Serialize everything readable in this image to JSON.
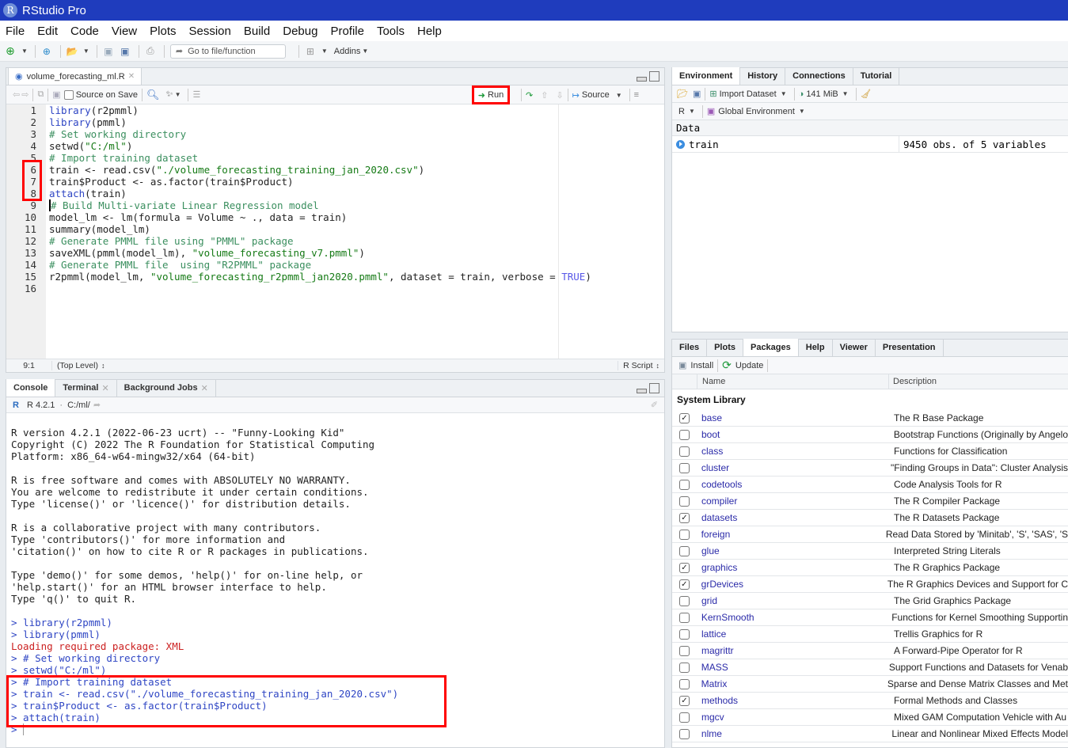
{
  "app": {
    "title": "RStudio Pro",
    "logo_letter": "R"
  },
  "menu": [
    "File",
    "Edit",
    "Code",
    "View",
    "Plots",
    "Session",
    "Build",
    "Debug",
    "Profile",
    "Tools",
    "Help"
  ],
  "toolbar": {
    "goto_placeholder": "Go to file/function",
    "addins_label": "Addins"
  },
  "source": {
    "tab_label": "volume_forecasting_ml.R",
    "source_on_save_label": "Source on Save",
    "run_label": "Run",
    "source_label": "Source",
    "line_numbers": [
      "1",
      "2",
      "3",
      "4",
      "5",
      "6",
      "7",
      "8",
      "9",
      "10",
      "11",
      "12",
      "13",
      "14",
      "15",
      "16"
    ],
    "status_position": "9:1",
    "status_scope": "(Top Level)",
    "status_type": "R Script"
  },
  "code": {
    "l1_fn": "library",
    "l1_rest": "(r2pmml)",
    "l2_fn": "library",
    "l2_rest": "(pmml)",
    "l3": "# Set working directory",
    "l4_a": "setwd(",
    "l4_s": "\"C:/ml\"",
    "l4_b": ")",
    "l5": "# Import training dataset",
    "l6_a": "train <- read.csv(",
    "l6_s": "\"./volume_forecasting_training_jan_2020.csv\"",
    "l6_b": ")",
    "l7": "train$Product <- as.factor(train$Product)",
    "l8_fn": "attach",
    "l8_rest": "(train)",
    "l9": "# Build Multi-variate Linear Regression model",
    "l10": "model_lm <- lm(formula = Volume ~ ., data = train)",
    "l11": "summary(model_lm)",
    "l12": "# Generate PMML file using \"PMML\" package",
    "l13_a": "saveXML(pmml(model_lm), ",
    "l13_s": "\"volume_forecasting_v7.pmml\"",
    "l13_b": ")",
    "l14": "# Generate PMML file  using \"R2PMML\" package",
    "l15_a": "r2pmml(model_lm, ",
    "l15_s": "\"volume_forecasting_r2pmml_jan2020.pmml\"",
    "l15_b": ", dataset = train, verbose = ",
    "l15_t": "TRUE",
    "l15_c": ")"
  },
  "console": {
    "tabs": [
      "Console",
      "Terminal",
      "Background Jobs"
    ],
    "r_version": "R 4.2.1",
    "path": "C:/ml/",
    "startup": [
      "R version 4.2.1 (2022-06-23 ucrt) -- \"Funny-Looking Kid\"",
      "Copyright (C) 2022 The R Foundation for Statistical Computing",
      "Platform: x86_64-w64-mingw32/x64 (64-bit)",
      "",
      "R is free software and comes with ABSOLUTELY NO WARRANTY.",
      "You are welcome to redistribute it under certain conditions.",
      "Type 'license()' or 'licence()' for distribution details.",
      "",
      "R is a collaborative project with many contributors.",
      "Type 'contributors()' for more information and",
      "'citation()' on how to cite R or R packages in publications.",
      "",
      "Type 'demo()' for some demos, 'help()' for on-line help, or",
      "'help.start()' for an HTML browser interface to help.",
      "Type 'q()' to quit R.",
      ""
    ],
    "cmd1": "> library(r2pmml)",
    "cmd2": "> library(pmml)",
    "msg": "Loading required package: XML",
    "cmd3": "> # Set working directory",
    "cmd4": "> setwd(\"C:/ml\")",
    "cmd5": "> # Import training dataset",
    "cmd6": "> train <- read.csv(\"./volume_forecasting_training_jan_2020.csv\")",
    "cmd7": "> train$Product <- as.factor(train$Product)",
    "cmd8": "> attach(train)",
    "prompt": "> "
  },
  "environment": {
    "tabs": [
      "Environment",
      "History",
      "Connections",
      "Tutorial"
    ],
    "import_label": "Import Dataset",
    "memory_label": "141 MiB",
    "lang_label": "R",
    "scope_label": "Global Environment",
    "section": "Data",
    "rows": [
      {
        "name": "train",
        "value": "9450 obs. of 5 variables"
      }
    ]
  },
  "packages": {
    "tabs": [
      "Files",
      "Plots",
      "Packages",
      "Help",
      "Viewer",
      "Presentation"
    ],
    "install_label": "Install",
    "update_label": "Update",
    "col_name": "Name",
    "col_desc": "Description",
    "section": "System Library",
    "items": [
      {
        "name": "base",
        "desc": "The R Base Package",
        "checked": true
      },
      {
        "name": "boot",
        "desc": "Bootstrap Functions (Originally by Angelo",
        "checked": false
      },
      {
        "name": "class",
        "desc": "Functions for Classification",
        "checked": false
      },
      {
        "name": "cluster",
        "desc": "\"Finding Groups in Data\": Cluster Analysis",
        "checked": false
      },
      {
        "name": "codetools",
        "desc": "Code Analysis Tools for R",
        "checked": false
      },
      {
        "name": "compiler",
        "desc": "The R Compiler Package",
        "checked": false
      },
      {
        "name": "datasets",
        "desc": "The R Datasets Package",
        "checked": true
      },
      {
        "name": "foreign",
        "desc": "Read Data Stored by 'Minitab', 'S', 'SAS', 'S",
        "checked": false
      },
      {
        "name": "glue",
        "desc": "Interpreted String Literals",
        "checked": false
      },
      {
        "name": "graphics",
        "desc": "The R Graphics Package",
        "checked": true
      },
      {
        "name": "grDevices",
        "desc": "The R Graphics Devices and Support for C",
        "checked": true
      },
      {
        "name": "grid",
        "desc": "The Grid Graphics Package",
        "checked": false
      },
      {
        "name": "KernSmooth",
        "desc": "Functions for Kernel Smoothing Supportin",
        "checked": false
      },
      {
        "name": "lattice",
        "desc": "Trellis Graphics for R",
        "checked": false
      },
      {
        "name": "magrittr",
        "desc": "A Forward-Pipe Operator for R",
        "checked": false
      },
      {
        "name": "MASS",
        "desc": "Support Functions and Datasets for Venab",
        "checked": false
      },
      {
        "name": "Matrix",
        "desc": "Sparse and Dense Matrix Classes and Met",
        "checked": false
      },
      {
        "name": "methods",
        "desc": "Formal Methods and Classes",
        "checked": true
      },
      {
        "name": "mgcv",
        "desc": "Mixed GAM Computation Vehicle with Au",
        "checked": false
      },
      {
        "name": "nlme",
        "desc": "Linear and Nonlinear Mixed Effects Model",
        "checked": false
      }
    ]
  }
}
